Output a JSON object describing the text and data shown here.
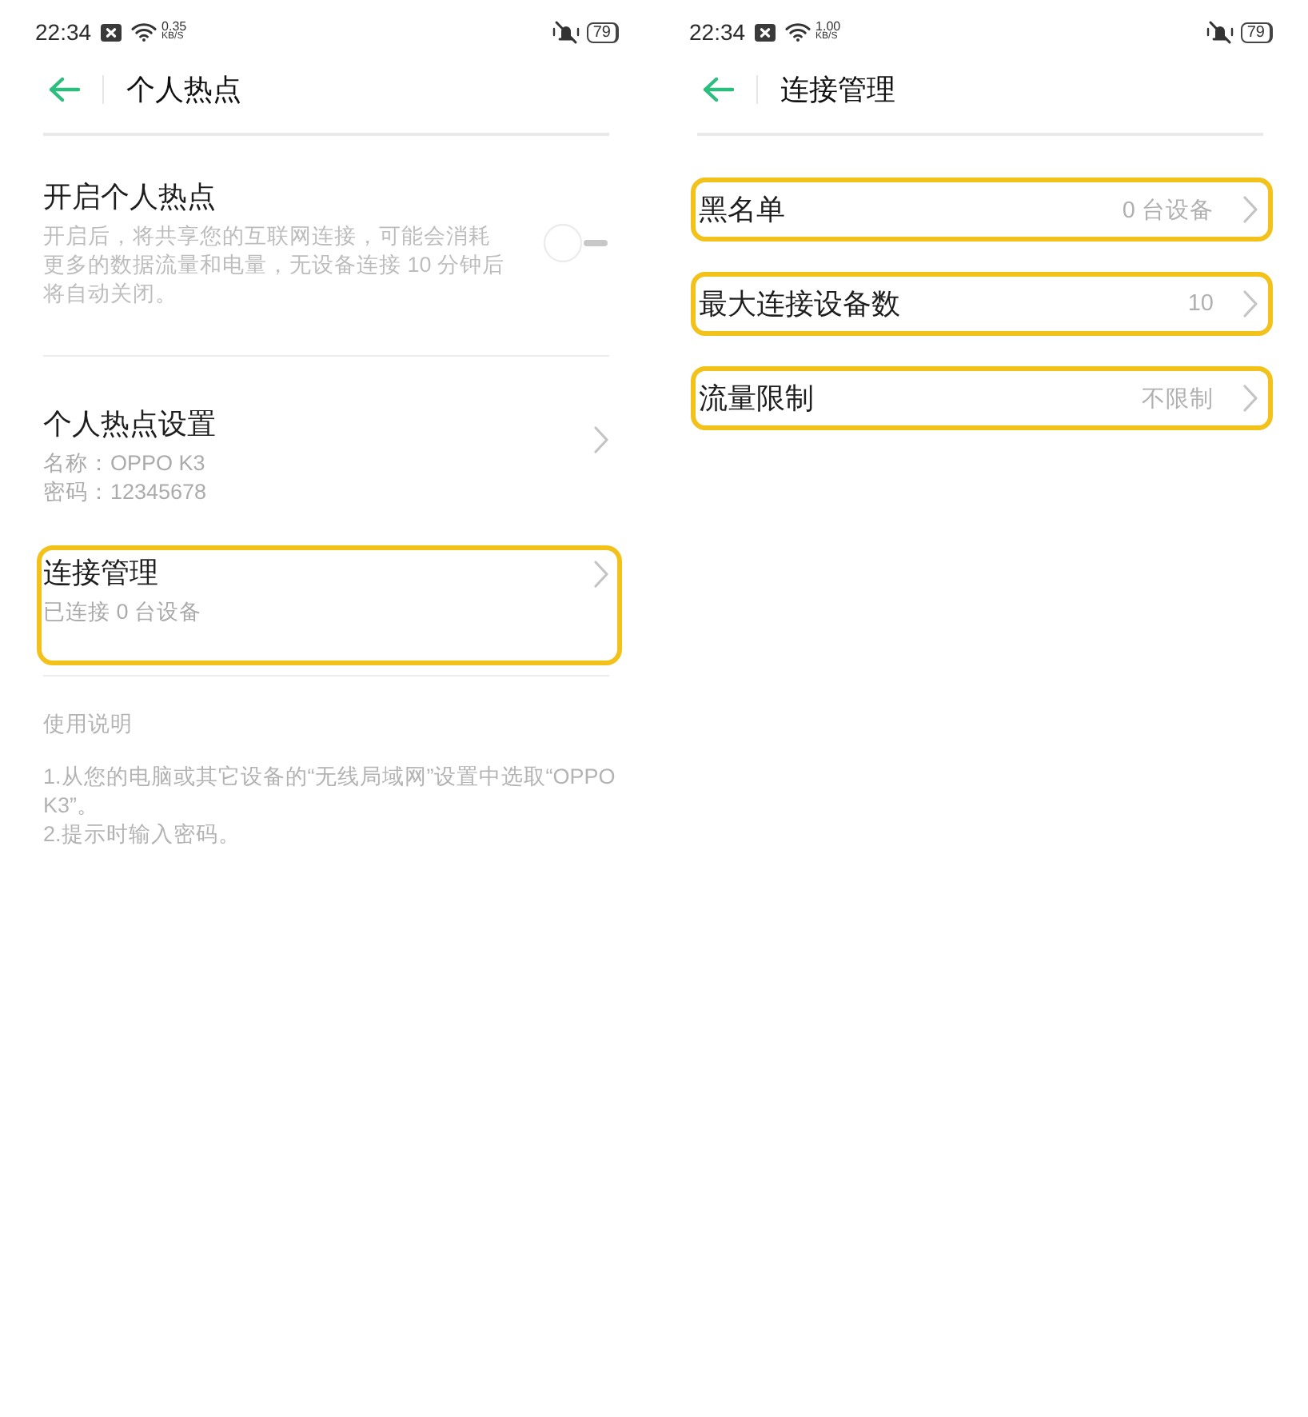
{
  "screens": [
    {
      "kind": "hotspot_settings",
      "status_bar": {
        "time": "22:34",
        "speed_value": "0.35",
        "speed_unit": "KB/S",
        "battery": "79"
      },
      "header": {
        "title": "个人热点"
      },
      "toggle_row": {
        "title": "开启个人热点",
        "description": "开启后，将共享您的互联网连接，可能会消耗更多的数据流量和电量，无设备连接 10 分钟后将自动关闭。",
        "on": false
      },
      "settings_rows": [
        {
          "title": "个人热点设置",
          "lines": [
            "名称：OPPO K3",
            "密码：12345678"
          ],
          "highlighted": false
        },
        {
          "title": "连接管理",
          "lines": [
            "已连接 0 台设备"
          ],
          "highlighted": true
        }
      ],
      "instructions": {
        "heading": "使用说明",
        "steps": [
          "1.从您的电脑或其它设备的“无线局域网”设置中选取“OPPO K3”。",
          "2.提示时输入密码。"
        ]
      }
    },
    {
      "kind": "connection_management",
      "status_bar": {
        "time": "22:34",
        "speed_value": "1.00",
        "speed_unit": "KB/S",
        "battery": "79"
      },
      "header": {
        "title": "连接管理"
      },
      "rows": [
        {
          "title": "黑名单",
          "value": "0 台设备",
          "highlighted": true
        },
        {
          "title": "最大连接设备数",
          "value": "10",
          "highlighted": true
        },
        {
          "title": "流量限制",
          "value": "不限制",
          "highlighted": true
        }
      ]
    }
  ]
}
